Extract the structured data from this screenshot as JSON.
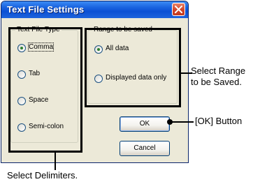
{
  "dialog": {
    "title": "Text File Settings",
    "close_icon": "close-icon"
  },
  "file_type_group": {
    "legend": "Text File Type",
    "options": [
      {
        "label": "Comma",
        "checked": true
      },
      {
        "label": "Tab",
        "checked": false
      },
      {
        "label": "Space",
        "checked": false
      },
      {
        "label": "Semi-colon",
        "checked": false
      }
    ]
  },
  "range_group": {
    "legend": "Range to be saved",
    "options": [
      {
        "label": "All data",
        "checked": true
      },
      {
        "label": "Displayed data only",
        "checked": false
      }
    ]
  },
  "buttons": {
    "ok": "OK",
    "cancel": "Cancel"
  },
  "annotations": {
    "range_line1": "Select Range",
    "range_line2": "to be Saved.",
    "ok_button": "[OK] Button",
    "delimiters": "Select Delimiters."
  },
  "colors": {
    "titlebar": "#0b50d4",
    "dialog_bg": "#ece9d8",
    "highlight": "#000000"
  }
}
